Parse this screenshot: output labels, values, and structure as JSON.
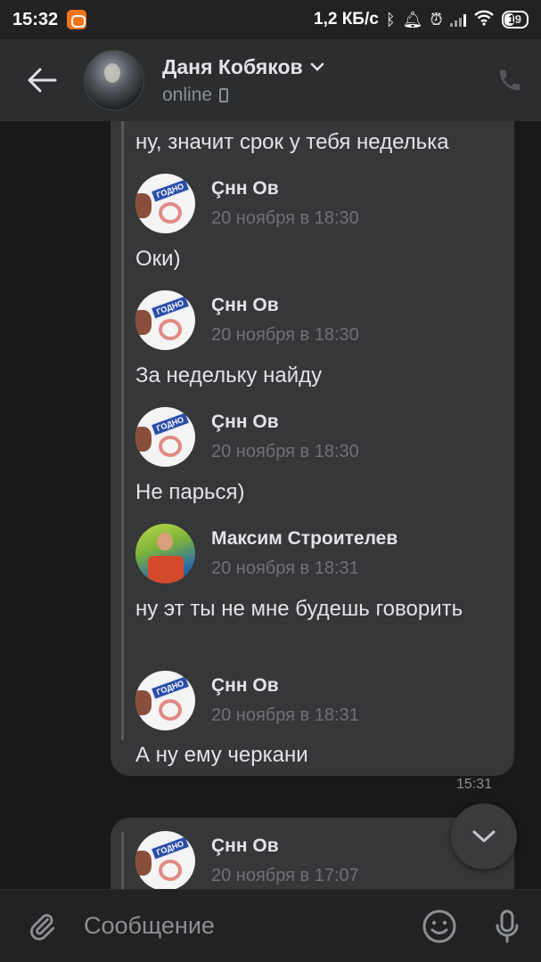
{
  "status_bar": {
    "time": "15:32",
    "network_speed": "1,2 КБ/с",
    "battery": "19"
  },
  "header": {
    "name": "Даня Кобяков",
    "status": "online"
  },
  "messages": {
    "bubble1": {
      "items": [
        {
          "kind": "text",
          "text": "ну, значит срок у тебя неделька"
        },
        {
          "kind": "sender",
          "name": "Çнн Ов",
          "date": "20 ноября в 18:30",
          "avatar": "goal"
        },
        {
          "kind": "text",
          "text": "Оки)"
        },
        {
          "kind": "sender",
          "name": "Çнн Ов",
          "date": "20 ноября в 18:30",
          "avatar": "goal"
        },
        {
          "kind": "text",
          "text": "За недельку найду"
        },
        {
          "kind": "sender",
          "name": "Çнн Ов",
          "date": "20 ноября в 18:30",
          "avatar": "goal"
        },
        {
          "kind": "text",
          "text": "Не парься)"
        },
        {
          "kind": "sender",
          "name": "Максим Строителев",
          "date": "20 ноября в 18:31",
          "avatar": "photo"
        },
        {
          "kind": "text",
          "text": "ну эт ты не мне будешь говорить"
        },
        {
          "kind": "sender",
          "name": "Çнн Ов",
          "date": "20 ноября в 18:31",
          "avatar": "goal"
        },
        {
          "kind": "text",
          "text": "А ну ему черкани"
        }
      ],
      "time": "15:31"
    },
    "bubble2": {
      "sender": {
        "name": "Çнн Ов",
        "date": "20 ноября в 17:07"
      }
    },
    "goal_avatar_text": "ГОДНО"
  },
  "composer": {
    "placeholder": "Сообщение"
  },
  "colors": {
    "background": "#19191a",
    "header": "#2c2d2e",
    "bubble": "#363738",
    "text": "#e1e3e6",
    "muted": "#8c8f93",
    "accent": "#f0741a"
  },
  "icons": [
    "back-arrow-icon",
    "chevron-down-icon",
    "phone-icon",
    "paperclip-icon",
    "smile-icon",
    "microphone-icon",
    "chevron-down-icon"
  ]
}
